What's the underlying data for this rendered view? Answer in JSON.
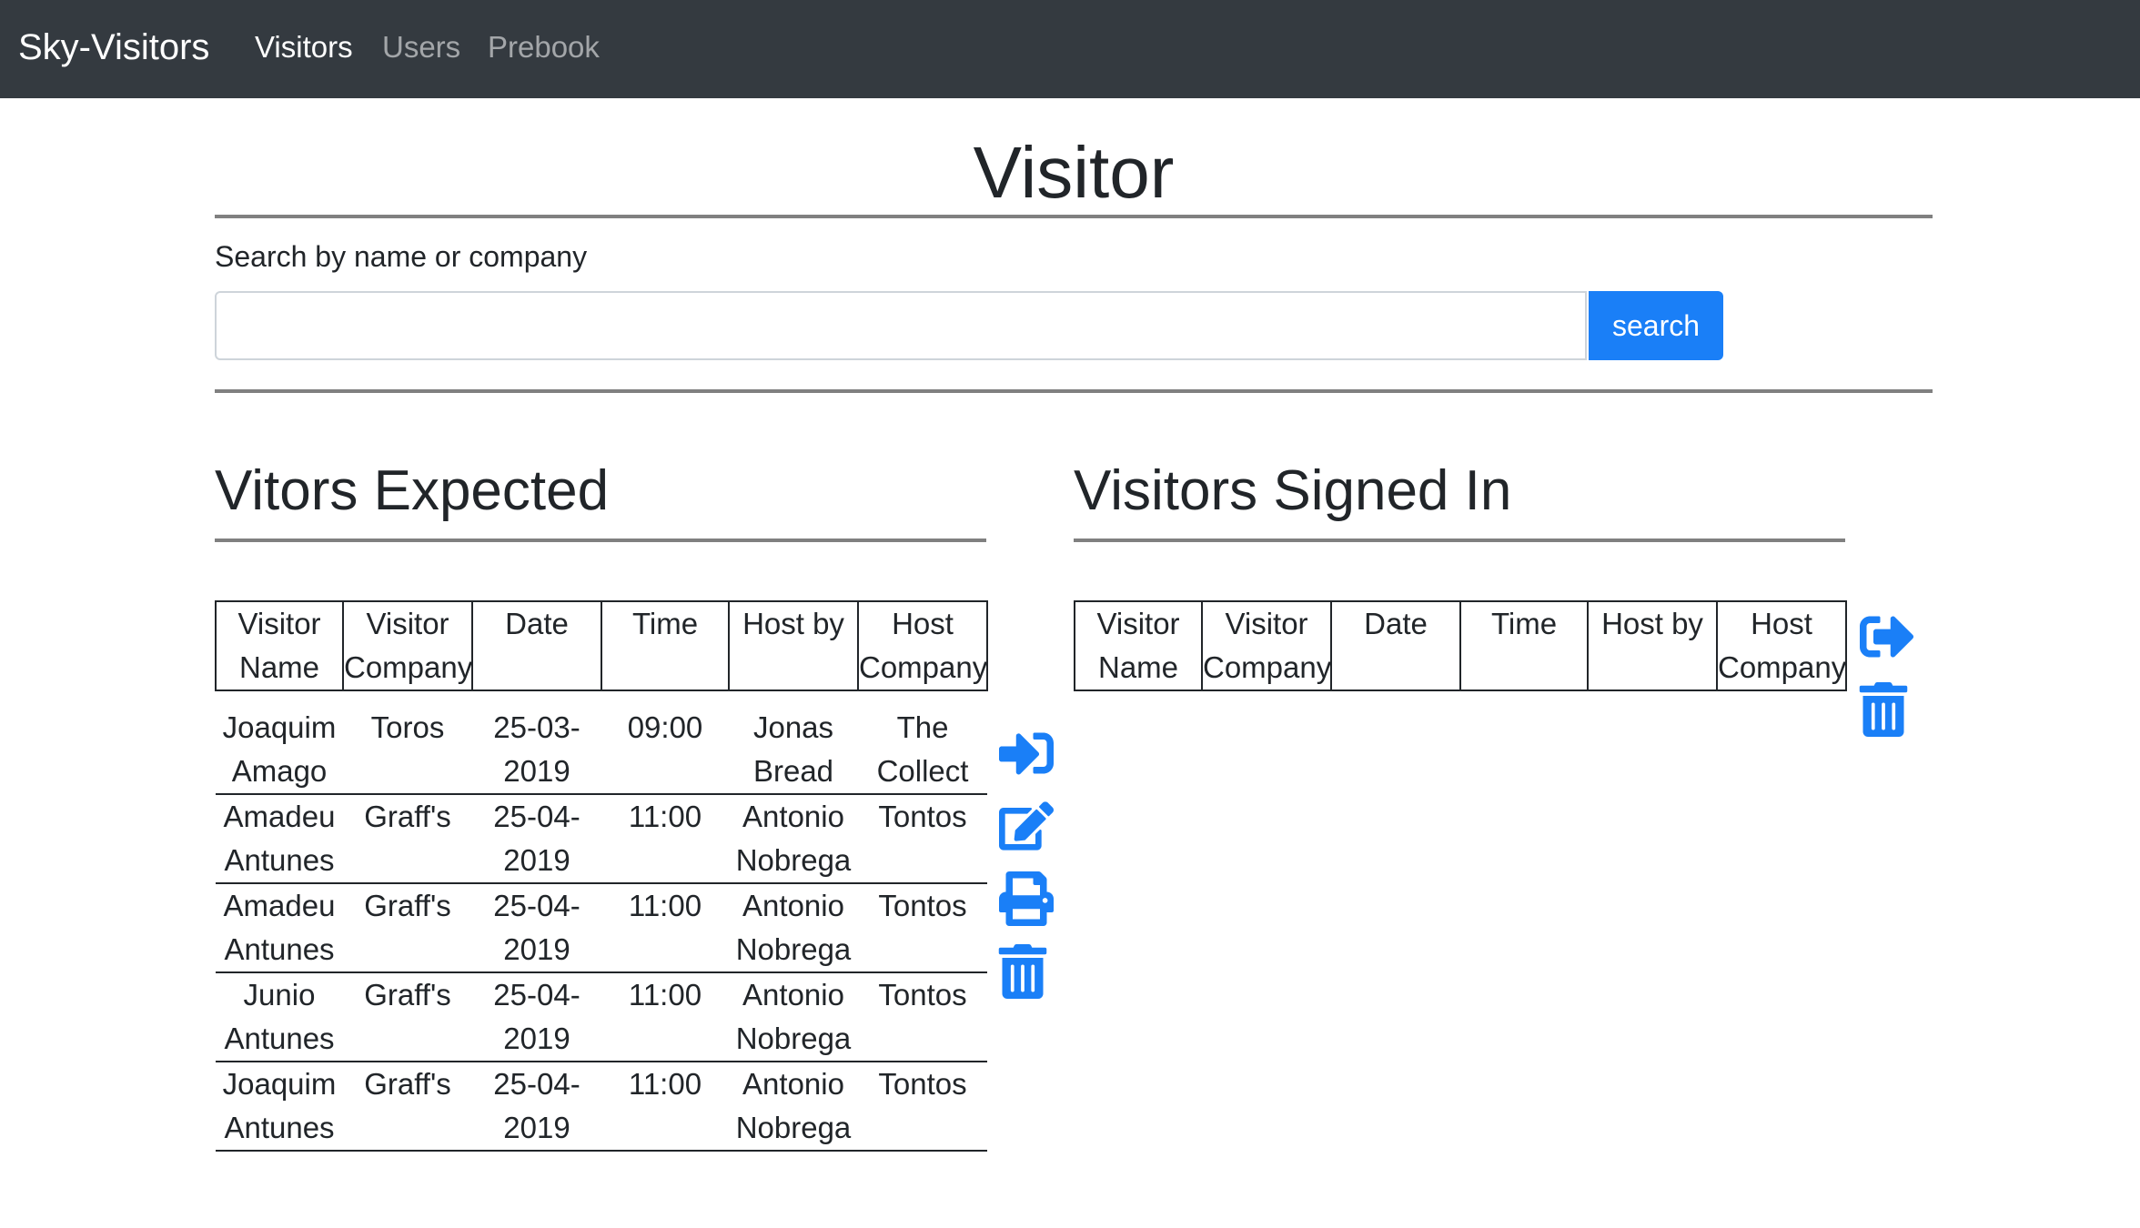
{
  "navbar": {
    "brand": "Sky-Visitors",
    "links": [
      {
        "label": "Visitors",
        "active": true
      },
      {
        "label": "Users",
        "active": false
      },
      {
        "label": "Prebook",
        "active": false
      }
    ]
  },
  "page_title": "Visitor",
  "search": {
    "label": "Search by name or company",
    "value": "",
    "placeholder": "",
    "button_label": "search"
  },
  "expected": {
    "title": "Vitors Expected",
    "headers": [
      "Visitor Name",
      "Visitor Company",
      "Date",
      "Time",
      "Host by",
      "Host Company"
    ],
    "rows": [
      [
        "Joaquim Amago",
        "Toros",
        "25-03-2019",
        "09:00",
        "Jonas Bread",
        "The Collect"
      ],
      [
        "Amadeu Antunes",
        "Graff's",
        "25-04-2019",
        "11:00",
        "Antonio Nobrega",
        "Tontos"
      ],
      [
        "Amadeu Antunes",
        "Graff's",
        "25-04-2019",
        "11:00",
        "Antonio Nobrega",
        "Tontos"
      ],
      [
        "Junio Antunes",
        "Graff's",
        "25-04-2019",
        "11:00",
        "Antonio Nobrega",
        "Tontos"
      ],
      [
        "Joaquim Antunes",
        "Graff's",
        "25-04-2019",
        "11:00",
        "Antonio Nobrega",
        "Tontos"
      ]
    ],
    "action_icons": [
      "sign-in-icon",
      "edit-icon",
      "print-icon",
      "trash-icon"
    ]
  },
  "signed_in": {
    "title": "Visitors Signed In",
    "headers": [
      "Visitor Name",
      "Visitor Company",
      "Date",
      "Time",
      "Host by",
      "Host Company"
    ],
    "rows": [],
    "action_icons": [
      "sign-out-icon",
      "trash-icon"
    ]
  },
  "colors": {
    "navbar_bg": "#343a40",
    "accent": "#1a7ff7",
    "text": "#212529",
    "divider": "#808080"
  }
}
